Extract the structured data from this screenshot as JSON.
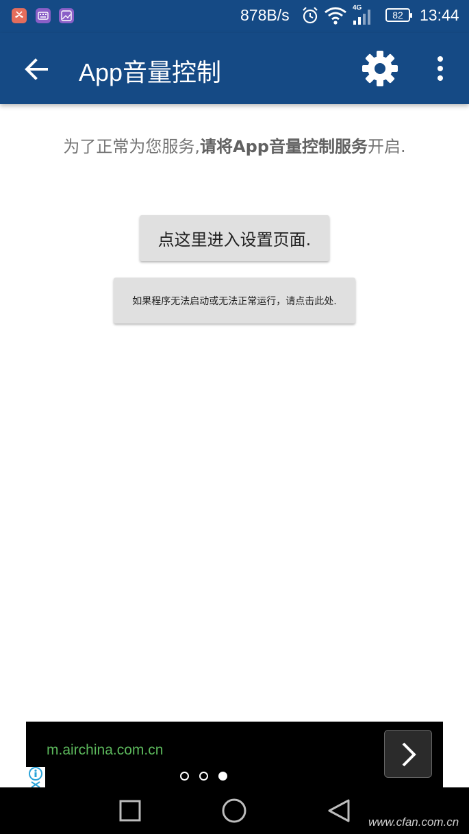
{
  "status_bar": {
    "net_speed": "878B/s",
    "signal_type": "4G",
    "battery": "82",
    "time": "13:44",
    "app_icons": [
      "missed-call-icon",
      "keyboard-icon",
      "gallery-icon"
    ]
  },
  "app_bar": {
    "title": "App音量控制"
  },
  "content": {
    "prompt_prefix": "为了正常为您服务,",
    "prompt_bold": "请将App音量控制服务",
    "prompt_suffix": "开启.",
    "settings_button": "点这里进入设置页面.",
    "help_button": "如果程序无法启动或无法正常运行，请点击此处."
  },
  "ad": {
    "url": "m.airchina.com.cn",
    "pages": 3,
    "active_page": 3
  },
  "watermark": "www.cfan.com.cn",
  "colors": {
    "primary": "#154a85",
    "ad_link": "#5cb85c"
  }
}
